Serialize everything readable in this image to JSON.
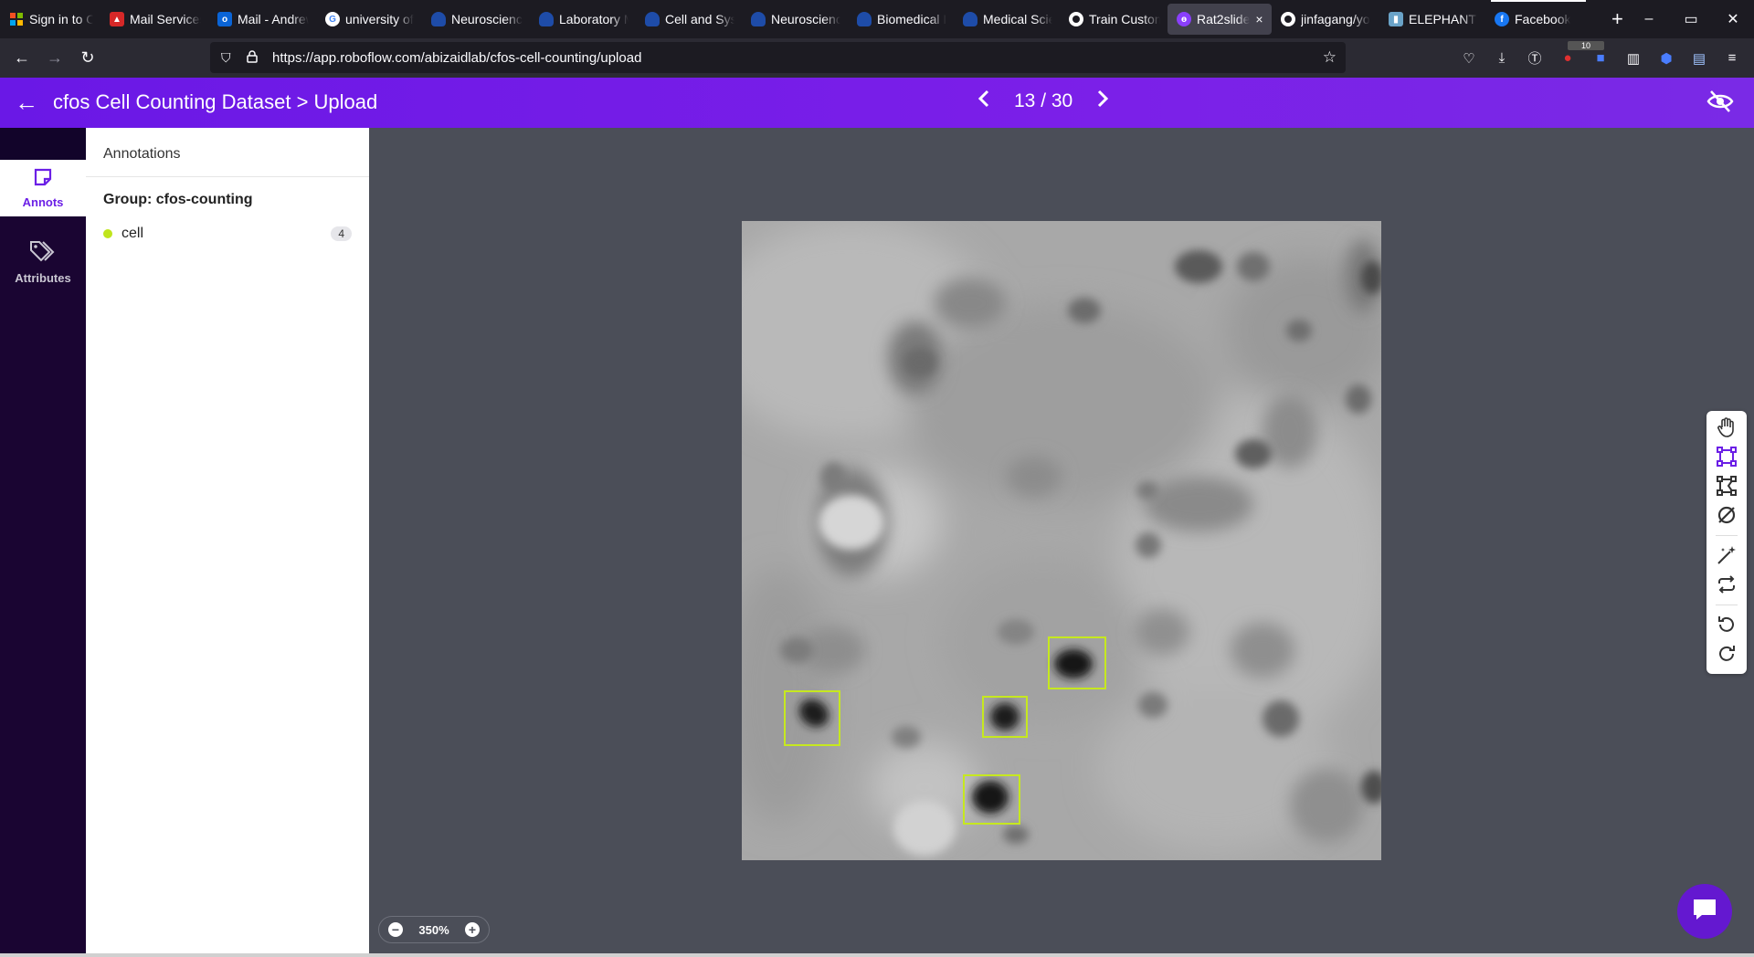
{
  "browser": {
    "tabs": [
      {
        "label": "Sign in to Out",
        "icon": "microsoft-icon",
        "color": "#f25022"
      },
      {
        "label": "Mail Services",
        "icon": "cap-icon",
        "color": "#d62828"
      },
      {
        "label": "Mail - Andrew",
        "icon": "outlook-icon",
        "color": "#0a64d6"
      },
      {
        "label": "university of",
        "icon": "google-icon",
        "color": "#ffffff"
      },
      {
        "label": "Neuroscience",
        "icon": "shield-icon",
        "color": "#1e4ca8"
      },
      {
        "label": "Laboratory M",
        "icon": "shield-icon",
        "color": "#1e4ca8"
      },
      {
        "label": "Cell and Syst",
        "icon": "shield-icon",
        "color": "#1e4ca8"
      },
      {
        "label": "Neuroscience",
        "icon": "shield-icon",
        "color": "#1e4ca8"
      },
      {
        "label": "Biomedical I",
        "icon": "shield-icon",
        "color": "#1e4ca8"
      },
      {
        "label": "Medical Scie",
        "icon": "shield-icon",
        "color": "#1e4ca8"
      },
      {
        "label": "Train Custom",
        "icon": "github-icon",
        "color": "#ffffff"
      },
      {
        "label": "Rat2slide",
        "icon": "roboflow-icon",
        "color": "#8a3ffc",
        "active": true
      },
      {
        "label": "jinfagang/yo",
        "icon": "github-icon",
        "color": "#ffffff"
      },
      {
        "label": "ELEPHANT D",
        "icon": "elephant-icon",
        "color": "#6aa3c8"
      },
      {
        "label": "Facebook",
        "icon": "facebook-icon",
        "color": "#1877f2"
      }
    ],
    "url": "https://app.roboflow.com/abizaidlab/cfos-cell-counting/upload",
    "extension_badge": "10"
  },
  "header": {
    "title": "cfos Cell Counting Dataset > Upload",
    "page_indicator": "13 / 30"
  },
  "rail": {
    "items": [
      {
        "label": "Annots",
        "icon": "annotation-icon",
        "active": true
      },
      {
        "label": "Attributes",
        "icon": "tag-icon",
        "active": false
      }
    ]
  },
  "panel": {
    "title": "Annotations",
    "group_label": "Group: cfos-counting",
    "classes": [
      {
        "name": "cell",
        "count": "4",
        "color": "#c0e51d"
      }
    ]
  },
  "canvas": {
    "zoom_label": "350%",
    "bbox_color": "#c6e81f",
    "tools": [
      "hand-icon",
      "bounding-box-icon",
      "polygon-icon",
      "null-icon",
      "magic-wand-icon",
      "repeat-icon",
      "undo-icon",
      "redo-icon"
    ]
  },
  "colors": {
    "accent": "#7b1fe8",
    "rail_bg": "#1a0532",
    "canvas_bg": "#4b4e58"
  }
}
